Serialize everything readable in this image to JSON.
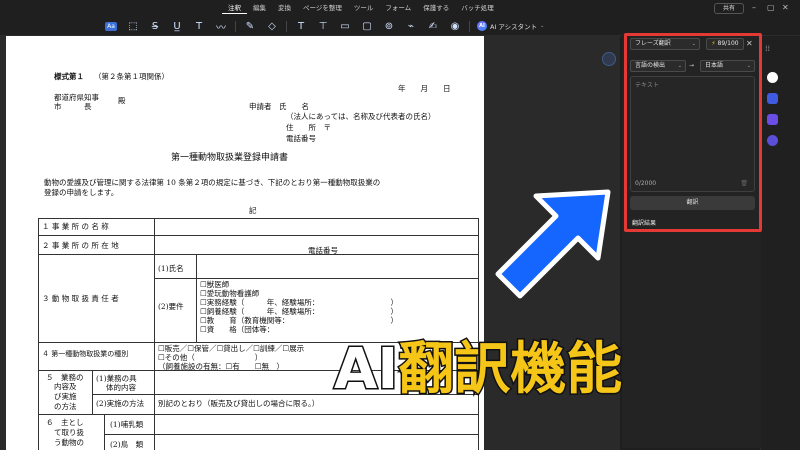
{
  "menu": {
    "items": [
      "注釈",
      "編集",
      "変換",
      "ページを整理",
      "ツール",
      "フォーム",
      "保護する",
      "バッチ処理"
    ],
    "active_index": 0,
    "share_label": "共有"
  },
  "toolbar": {
    "ai_label": "AI アシスタント",
    "text_tool_label": "Aa"
  },
  "document": {
    "form_number": "様式第１",
    "form_ref": "（第２条第１項関係）",
    "date_line": "年　　月　　日",
    "addressee_1": "都道府県知事",
    "addressee_2": "市　　　長",
    "honorific": "殿",
    "applicant": "申請者　氏　　名",
    "applicant_note": "（法人にあっては、名称及び代表者の氏名）",
    "address": "住　　所　〒",
    "phone": "電話番号",
    "title": "第一種動物取扱業登録申請書",
    "body_1": "動物の愛護及び管理に関する法律第 10 条第２項の規定に基づき、下記のとおり第一種動物取扱業の",
    "body_2": "登録の申請をします。",
    "ki": "記",
    "rows": {
      "r1": "１ 事 業 所 の 名 称",
      "r2": "２ 事 業 所 の 所 在 地",
      "r2_phone": "電話番号",
      "r3": "３ 動 物 取 扱 責 任 者",
      "r3_name": "(1)氏名",
      "r3_req": "(2)要件",
      "req_1": "☐獣医師",
      "req_2": "☐愛玩動物看護師",
      "req_3": "☐実務経験（　　　年、経験場所：　　　　　　　　　　）",
      "req_4": "☐飼養経験（　　　年、経験場所：　　　　　　　　　　）",
      "req_5": "☐教　　育（教育機関等：　　　　　　　　　　　　　　）",
      "req_6": "☐資　　格（団体等：",
      "r4": "４ 第一種動物取扱業の種別",
      "r4_a": "☐販売／☐保管／☐貸出し／☐訓練／☐展示",
      "r4_b": "☐その他（　　　　　　　　）",
      "r4_c": "（飼養施設の有無：☐有　　☐無　）",
      "r5_a": "５　業務の",
      "r5_b": "内容及",
      "r5_c": "び実施",
      "r5_d": "の方法",
      "r5_1a": "(1)業務の具",
      "r5_1b": "体的内容",
      "r5_2": "(2)実施の方法",
      "r5_2_val": "別記のとおり（販売及び貸出しの場合に限る。）",
      "r6_a": "６　主とし",
      "r6_b": "て取り扱",
      "r6_c": "う動物の",
      "r6_1": "(1)哺乳類",
      "r6_2": "(2)鳥　類"
    }
  },
  "panel": {
    "mode": "フレーズ翻訳",
    "quota": "89/100",
    "source_lang": "言語の検出",
    "target_lang": "日本語",
    "placeholder": "テキスト",
    "counter": "0/2000",
    "translate_label": "翻訳",
    "result_label": "翻訳結果"
  },
  "overlay": {
    "caption": "AI翻訳機能"
  },
  "colors": {
    "highlight_red": "#e53935",
    "arrow_blue": "#1565ff",
    "caption_yellow": "#f5c518"
  }
}
